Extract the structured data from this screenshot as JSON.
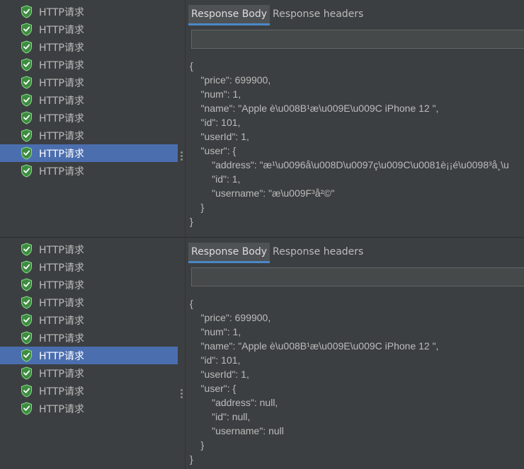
{
  "colors": {
    "background": "#3c3f41",
    "selection": "#4b6eaf",
    "tab_active_underline": "#4a88c7",
    "icon_green": "#4caf50"
  },
  "panels": [
    {
      "tree": {
        "items": [
          {
            "label": "HTTP请求"
          },
          {
            "label": "HTTP请求"
          },
          {
            "label": "HTTP请求"
          },
          {
            "label": "HTTP请求"
          },
          {
            "label": "HTTP请求"
          },
          {
            "label": "HTTP请求"
          },
          {
            "label": "HTTP请求"
          },
          {
            "label": "HTTP请求"
          },
          {
            "label": "HTTP请求"
          },
          {
            "label": "HTTP请求"
          }
        ],
        "selected_index": 8
      },
      "tabs": {
        "response_body": "Response Body",
        "response_headers": "Response headers"
      },
      "search_value": "",
      "body_lines": [
        "{",
        "    \"price\": 699900,",
        "    \"num\": 1,",
        "    \"name\": \"Apple è\\u008B¹æ\\u009E\\u009C iPhone 12 \",",
        "    \"id\": 101,",
        "    \"userId\": 1,",
        "    \"user\": {",
        "        \"address\": \"æ¹\\u0096å\\u008D\\u0097ç\\u009C\\u0081è¡¡é\\u0098³å¸\\u",
        "        \"id\": 1,",
        "        \"username\": \"æ\\u009F³å²©\"",
        "    }",
        "}"
      ]
    },
    {
      "tree": {
        "items": [
          {
            "label": "HTTP请求"
          },
          {
            "label": "HTTP请求"
          },
          {
            "label": "HTTP请求"
          },
          {
            "label": "HTTP请求"
          },
          {
            "label": "HTTP请求"
          },
          {
            "label": "HTTP请求"
          },
          {
            "label": "HTTP请求"
          },
          {
            "label": "HTTP请求"
          },
          {
            "label": "HTTP请求"
          },
          {
            "label": "HTTP请求"
          }
        ],
        "selected_index": 6
      },
      "tabs": {
        "response_body": "Response Body",
        "response_headers": "Response headers"
      },
      "search_value": "",
      "body_lines": [
        "{",
        "    \"price\": 699900,",
        "    \"num\": 1,",
        "    \"name\": \"Apple è\\u008B¹æ\\u009E\\u009C iPhone 12 \",",
        "    \"id\": 101,",
        "    \"userId\": 1,",
        "    \"user\": {",
        "        \"address\": null,",
        "        \"id\": null,",
        "        \"username\": null",
        "    }",
        "}"
      ]
    }
  ]
}
